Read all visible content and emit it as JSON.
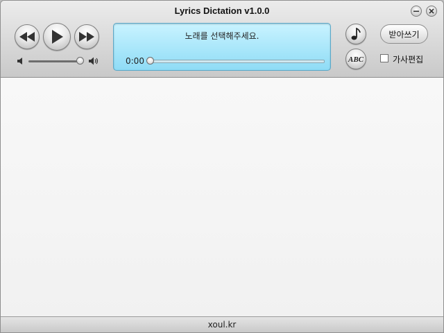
{
  "app": {
    "title": "Lyrics Dictation v1.0.0"
  },
  "window_controls": [
    {
      "icon": "minimize-icon"
    },
    {
      "icon": "close-icon"
    }
  ],
  "player": {
    "buttons": [
      {
        "icon": "rewind-icon"
      },
      {
        "icon": "play-icon"
      },
      {
        "icon": "fast-forward-icon"
      }
    ],
    "volume": {
      "level": 0.95,
      "min_icon": "volume-low-icon",
      "max_icon": "volume-high-icon"
    }
  },
  "display": {
    "message": "노래를 선택해주세요.",
    "time": "0:00",
    "progress": 0
  },
  "side_buttons": [
    {
      "icon": "music-note-icon"
    },
    {
      "icon": "abc-spellcheck-icon",
      "text": "ABC"
    }
  ],
  "actions": {
    "dictation_label": "받아쓰기",
    "edit_lyrics_label": "가사편집",
    "edit_lyrics_checked": false
  },
  "status": {
    "text": "xoul.kr"
  },
  "colors": {
    "display_bg": "#a9e8fb",
    "display_border": "#5aa7c7"
  }
}
